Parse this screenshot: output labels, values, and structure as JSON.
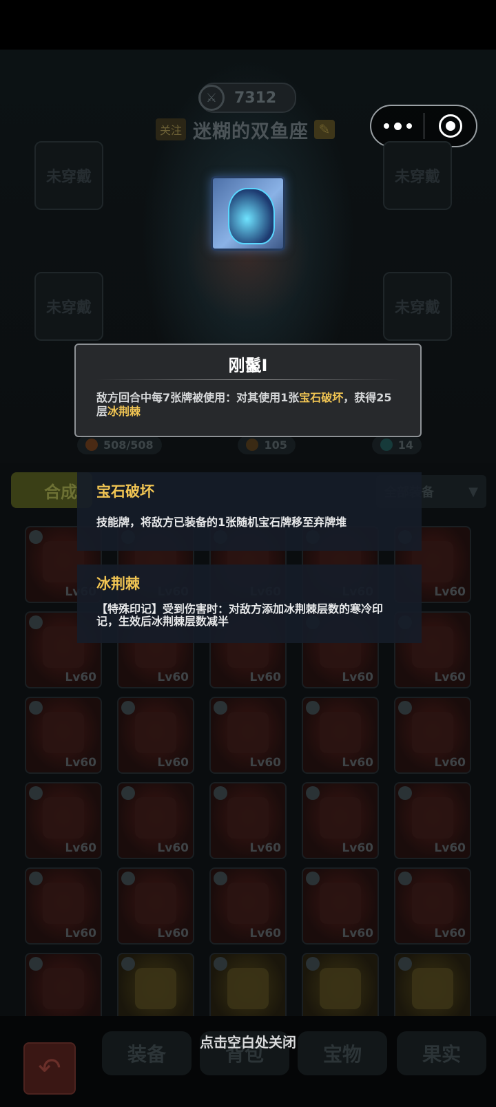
{
  "header": {
    "power_value": "7312",
    "follow_label": "关注",
    "player_name": "迷糊的双鱼座"
  },
  "capsule": {
    "menu_icon": "more-dots-icon",
    "close_icon": "close-target-icon"
  },
  "equip_slots": {
    "empty_label": "未穿戴"
  },
  "stats": {
    "hp": "508/508",
    "attack": "105",
    "defense": "14"
  },
  "skill_tooltip": {
    "title": "刚鬣I",
    "desc_part1": "敌方回合中每7张牌被使用：对其使用1张",
    "desc_hl1": "宝石破坏",
    "desc_part2": "，获得25层",
    "desc_hl2": "冰荆棘"
  },
  "keyword_tips": [
    {
      "title": "宝石破坏",
      "desc": "技能牌，将敌方已装备的1张随机宝石牌移至弃牌堆"
    },
    {
      "title": "冰荆棘",
      "desc": "【特殊印记】受到伤害时：对敌方添加冰荆棘层数的寒冷印记，生效后冰荆棘层数减半"
    }
  ],
  "bag": {
    "left_tab": "合成",
    "filter_label": "全部装备",
    "level_label": "Lv60"
  },
  "bottom_tabs": {
    "equip": "装备",
    "backpack": "背包",
    "treasure": "宝物",
    "fruit": "果实"
  },
  "close_hint": "点击空白处关闭",
  "colors": {
    "highlight": "#f1c553",
    "tooltip_bg": "#27292c",
    "keyword_bg": "#161c28"
  }
}
